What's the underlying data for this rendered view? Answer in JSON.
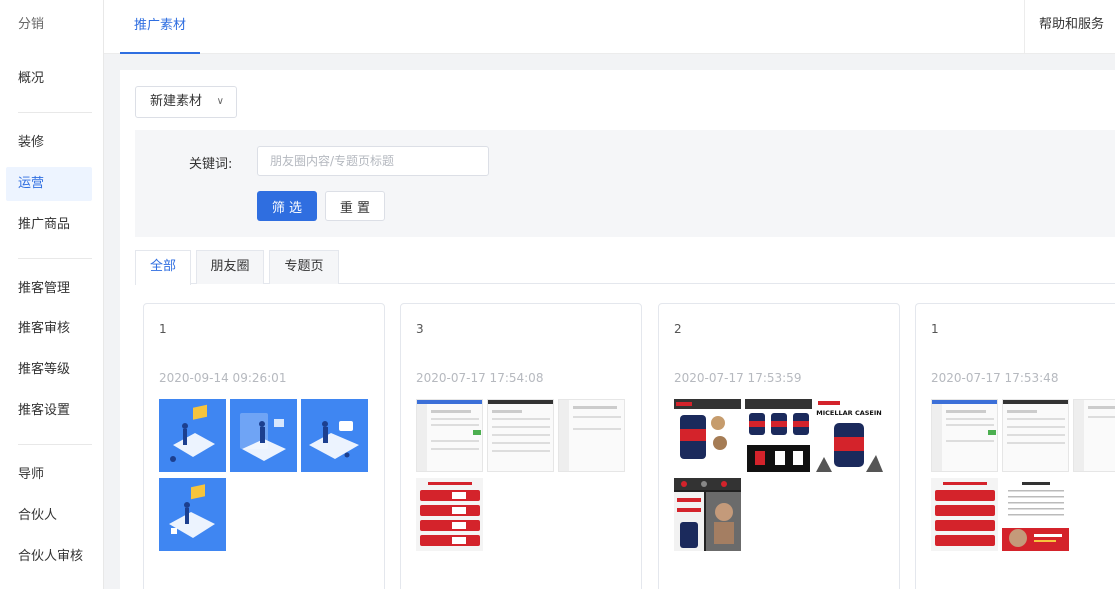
{
  "sidebar": {
    "title": "分销",
    "items": [
      {
        "label": "概况",
        "active": false
      },
      {
        "label": "装修",
        "active": false
      },
      {
        "label": "运营",
        "active": true
      },
      {
        "label": "推广商品",
        "active": false
      },
      {
        "label": "推客管理",
        "active": false
      },
      {
        "label": "推客审核",
        "active": false
      },
      {
        "label": "推客等级",
        "active": false
      },
      {
        "label": "推客设置",
        "active": false
      },
      {
        "label": "导师",
        "active": false
      },
      {
        "label": "合伙人",
        "active": false
      },
      {
        "label": "合伙人审核",
        "active": false
      }
    ]
  },
  "topbar": {
    "tab": "推广素材",
    "help": "帮助和服务"
  },
  "toolbar": {
    "new_label": "新建素材",
    "new_caret": "∨"
  },
  "filter": {
    "keyword_label": "关键词:",
    "keyword_placeholder": "朋友圈内容/专题页标题",
    "keyword_value": "",
    "filter_label": "筛 选",
    "reset_label": "重 置"
  },
  "tabs": [
    {
      "label": "全部",
      "active": true
    },
    {
      "label": "朋友圈",
      "active": false
    },
    {
      "label": "专题页",
      "active": false
    }
  ],
  "cards": [
    {
      "count": "1",
      "date": "2020-09-14 09:26:01"
    },
    {
      "count": "3",
      "date": "2020-07-17 17:54:08"
    },
    {
      "count": "2",
      "date": "2020-07-17 17:53:59"
    },
    {
      "count": "1",
      "date": "2020-07-17 17:53:48"
    }
  ],
  "images": {
    "casein_title": "MICELLAR CASEIN"
  },
  "colors": {
    "accent": "#2f6ee0",
    "illustration_blue": "#3f86f2",
    "product_red": "#d4232b"
  }
}
